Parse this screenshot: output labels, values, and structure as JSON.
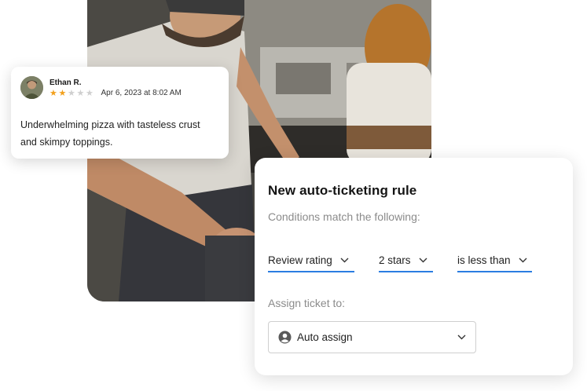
{
  "review": {
    "name": "Ethan R.",
    "rating": 2,
    "max_rating": 5,
    "date": "Apr 6, 2023 at 8:02 AM",
    "text_line1": "Underwhelming pizza with tasteless crust",
    "text_line2": "and skimpy toppings."
  },
  "rule": {
    "title": "New auto-ticketing rule",
    "subtitle": "Conditions match the following:",
    "conditions": {
      "field": "Review rating",
      "value": "2 stars",
      "operator": "is less than"
    },
    "assign_label": "Assign ticket to:",
    "assign_value": "Auto assign"
  },
  "colors": {
    "accent": "#2a7de1",
    "star_on": "#f2a01c",
    "star_off": "#cfcfcf"
  },
  "icons": {
    "assign": "user-circle-icon",
    "dropdown": "chevron-down-icon"
  }
}
